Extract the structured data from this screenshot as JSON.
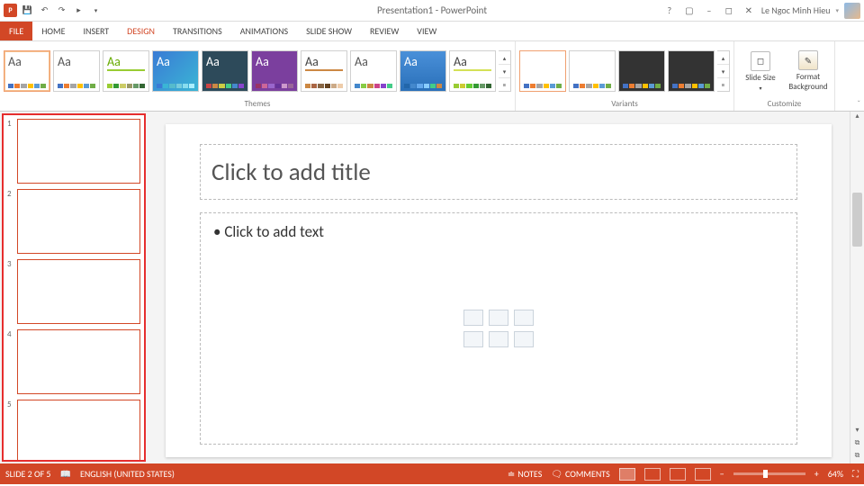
{
  "title": "Presentation1 - PowerPoint",
  "user": "Le Ngoc Minh Hieu",
  "tabs": [
    "FILE",
    "HOME",
    "INSERT",
    "DESIGN",
    "TRANSITIONS",
    "ANIMATIONS",
    "SLIDE SHOW",
    "REVIEW",
    "VIEW"
  ],
  "active_tab": "DESIGN",
  "ribbon": {
    "themes_label": "Themes",
    "variants_label": "Variants",
    "customize_label": "Customize",
    "slide_size": "Slide Size",
    "format_bg": "Format Background",
    "themes": [
      {
        "aa": "#555",
        "bg": "#fff",
        "sel": true,
        "colors": [
          "#4472c4",
          "#ed7d31",
          "#a5a5a5",
          "#ffc000",
          "#5b9bd5",
          "#70ad47"
        ]
      },
      {
        "aa": "#555",
        "bg": "#fff",
        "colors": [
          "#4472c4",
          "#ed7d31",
          "#a5a5a5",
          "#ffc000",
          "#5b9bd5",
          "#70ad47"
        ]
      },
      {
        "aa": "#6a0",
        "bg": "#fff",
        "accent": "#9c3",
        "colors": [
          "#9c3",
          "#393",
          "#cc6",
          "#996",
          "#696",
          "#363"
        ]
      },
      {
        "aa": "#fff",
        "bg": "linear-gradient(135deg,#3a7bd5,#3ab5d5)",
        "colors": [
          "#3a7bd5",
          "#3ab5d5",
          "#5bc",
          "#7cd",
          "#8de",
          "#aef"
        ]
      },
      {
        "aa": "#fff",
        "bg": "#2d4a5a",
        "colors": [
          "#c44",
          "#c84",
          "#cc4",
          "#4c8",
          "#48c",
          "#84c"
        ]
      },
      {
        "aa": "#fff",
        "bg": "#7b3f9e",
        "colors": [
          "#936",
          "#c69",
          "#96c",
          "#639",
          "#c9c",
          "#969"
        ]
      },
      {
        "aa": "#444",
        "bg": "#fff",
        "accent": "#cc8844",
        "colors": [
          "#c84",
          "#a64",
          "#864",
          "#642",
          "#ca8",
          "#eca"
        ]
      },
      {
        "aa": "#555",
        "bg": "#fff",
        "colors": [
          "#48c",
          "#8c4",
          "#c84",
          "#c48",
          "#84c",
          "#4c8"
        ]
      },
      {
        "aa": "#fff",
        "bg": "linear-gradient(#4a90d9,#2a70b9)",
        "colors": [
          "#26a",
          "#48c",
          "#6ae",
          "#8cf",
          "#4c8",
          "#c84"
        ]
      },
      {
        "aa": "#444",
        "bg": "#fff",
        "accent": "#d4e157",
        "colors": [
          "#9c3",
          "#cc3",
          "#6c3",
          "#393",
          "#696",
          "#363"
        ]
      }
    ],
    "variants": [
      {
        "bg": "#fff",
        "sel": true
      },
      {
        "bg": "#fff"
      },
      {
        "bg": "#333",
        "dark": true
      },
      {
        "bg": "#333",
        "dark": true
      }
    ],
    "variant_colors": [
      "#4472c4",
      "#ed7d31",
      "#a5a5a5",
      "#ffc000",
      "#5b9bd5",
      "#70ad47"
    ]
  },
  "slide": {
    "title_placeholder": "Click to add title",
    "body_placeholder": "Click to add text"
  },
  "thumbs": [
    1,
    2,
    3,
    4,
    5
  ],
  "status": {
    "slide": "SLIDE 2 OF 5",
    "lang": "ENGLISH (UNITED STATES)",
    "notes": "NOTES",
    "comments": "COMMENTS",
    "zoom": "64%"
  }
}
